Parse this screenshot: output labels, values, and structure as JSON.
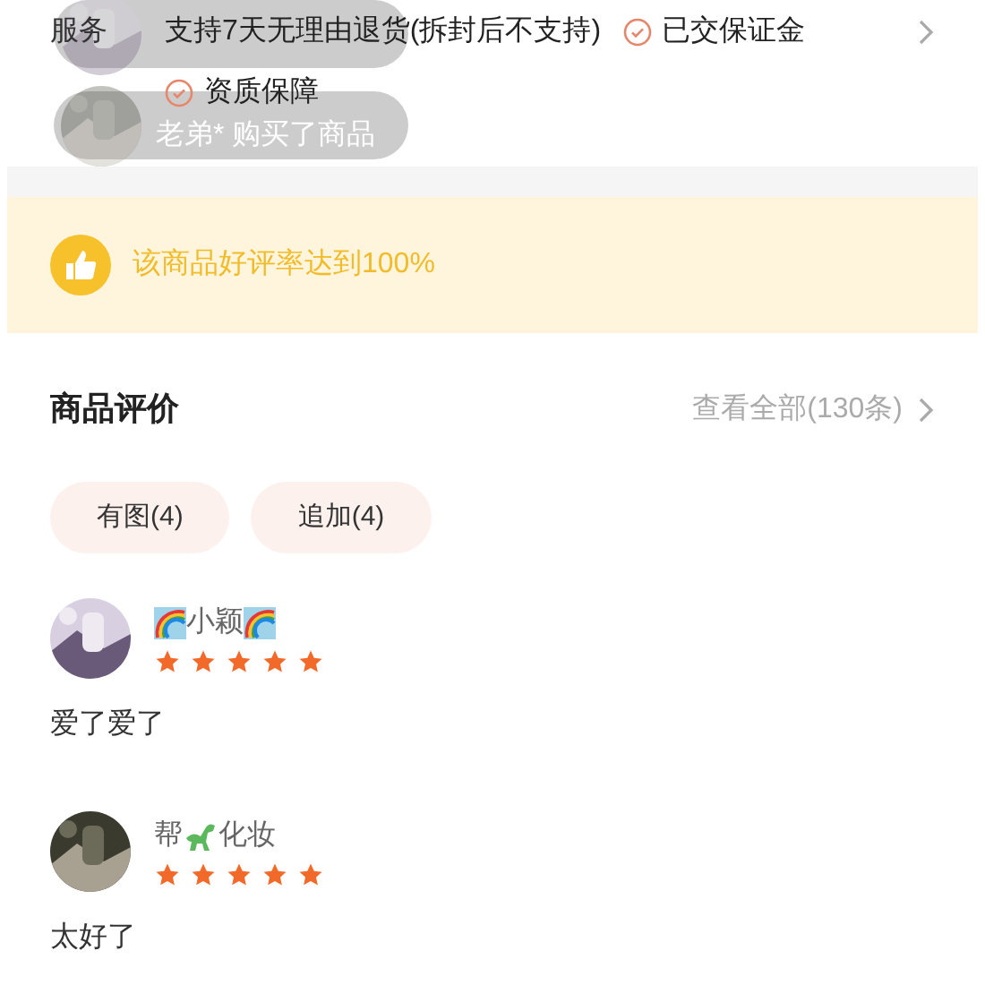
{
  "services": {
    "label": "服务",
    "items": [
      "支持7天无理由退货(拆封后不支持)",
      "已交保证金",
      "资质保障"
    ]
  },
  "toasts": [
    {
      "kind": "avatar_only"
    },
    {
      "kind": "text",
      "text": "老弟* 购买了商品"
    }
  ],
  "banner": {
    "text": "该商品好评率达到100%"
  },
  "reviews_header": {
    "title": "商品评价",
    "link": "查看全部(130条)"
  },
  "filters": [
    {
      "label": "有图(4)"
    },
    {
      "label": "追加(4)"
    }
  ],
  "reviews": [
    {
      "name": [
        {
          "kind": "rainbow"
        },
        {
          "kind": "text",
          "text": "小颖"
        },
        {
          "kind": "rainbow"
        }
      ],
      "stars": 5,
      "text": "爱了爱了"
    },
    {
      "name": [
        {
          "kind": "text",
          "text": "帮"
        },
        {
          "kind": "dinosaur"
        },
        {
          "kind": "text",
          "text": "化妆"
        }
      ],
      "stars": 5,
      "text": "太好了"
    }
  ]
}
